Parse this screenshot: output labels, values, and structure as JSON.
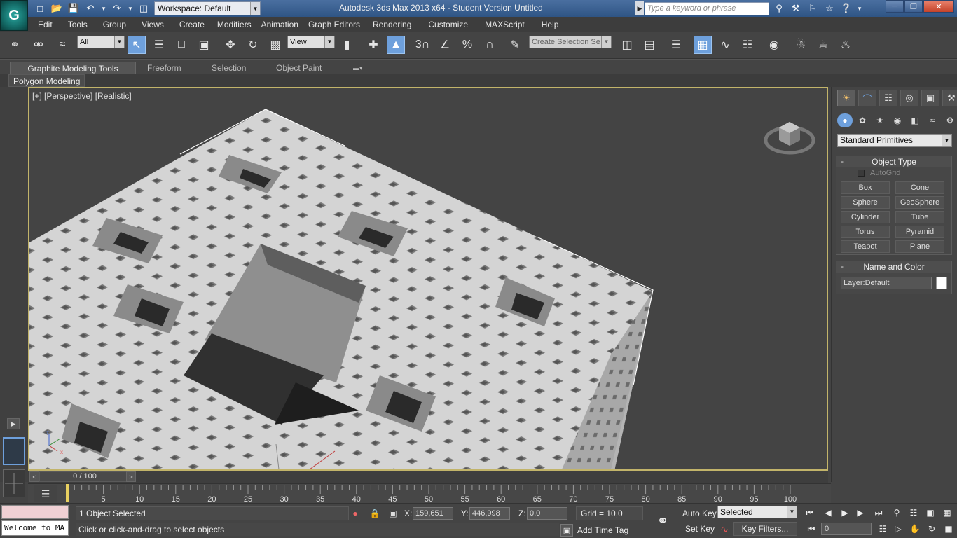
{
  "titlebar": {
    "workspace": "Workspace: Default",
    "title": "Autodesk 3ds Max 2013 x64 - Student Version   Untitled",
    "search_placeholder": "Type a keyword or phrase"
  },
  "menu": [
    "Edit",
    "Tools",
    "Group",
    "Views",
    "Create",
    "Modifiers",
    "Animation",
    "Graph Editors",
    "Rendering",
    "Customize",
    "MAXScript",
    "Help"
  ],
  "toolbar": {
    "filter": "All",
    "ref_coord": "View",
    "snap_angle": "3",
    "selection_set": "Create Selection Se"
  },
  "ribbon": {
    "tabs": [
      "Graphite Modeling Tools",
      "Freeform",
      "Selection",
      "Object Paint"
    ],
    "panel": "Polygon Modeling"
  },
  "viewport": {
    "label": "[+] [Perspective] [Realistic]"
  },
  "command_panel": {
    "category": "Standard Primitives",
    "object_type_title": "Object Type",
    "autogrid": "AutoGrid",
    "primitives": [
      "Box",
      "Cone",
      "Sphere",
      "GeoSphere",
      "Cylinder",
      "Tube",
      "Torus",
      "Pyramid",
      "Teapot",
      "Plane"
    ],
    "name_color_title": "Name and Color",
    "name_value": "Layer:Default",
    "swatch_color": "#ffffff"
  },
  "timeline": {
    "frame": "0 / 100",
    "ticks": [
      "5",
      "10",
      "15",
      "20",
      "25",
      "30",
      "35",
      "40",
      "45",
      "50",
      "55",
      "60",
      "65",
      "70",
      "75",
      "80",
      "85",
      "90",
      "95",
      "100"
    ]
  },
  "status": {
    "maxscript": "Welcome to MA",
    "selection": "1 Object Selected",
    "prompt": "Click or click-and-drag to select objects",
    "x_label": "X:",
    "x_value": "159,651",
    "y_label": "Y:",
    "y_value": "446,998",
    "z_label": "Z:",
    "z_value": "0,0",
    "grid": "Grid = 10,0",
    "add_time_tag": "Add Time Tag",
    "auto_key": "Auto Key",
    "set_key": "Set Key",
    "key_mode": "Selected",
    "key_filters": "Key Filters...",
    "current_frame": "0"
  }
}
